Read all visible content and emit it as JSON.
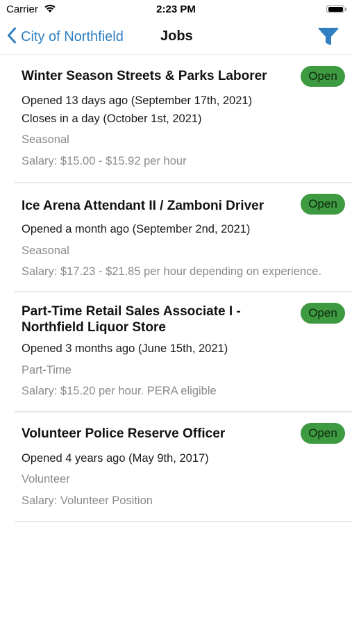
{
  "status_bar": {
    "carrier": "Carrier",
    "time": "2:23 PM"
  },
  "nav": {
    "back_label": "City of Northfield",
    "title": "Jobs",
    "accent_color": "#2f7fc1"
  },
  "jobs": [
    {
      "title": "Winter Season Streets & Parks Laborer",
      "status": "Open",
      "opened": "Opened 13 days ago (September 17th, 2021)",
      "closes": "Closes in a day (October 1st, 2021)",
      "type": "Seasonal",
      "salary": "Salary: $15.00 - $15.92 per hour"
    },
    {
      "title": "Ice Arena Attendant II / Zamboni Driver",
      "status": "Open",
      "opened": "Opened a month ago (September 2nd, 2021)",
      "type": "Seasonal",
      "salary": "Salary: $17.23 - $21.85 per hour depending on experience."
    },
    {
      "title_line1": "Part-Time Retail Sales Associate I -",
      "title_line2": "Northfield Liquor Store",
      "status": "Open",
      "opened": "Opened 3 months ago (June 15th, 2021)",
      "type": "Part-Time",
      "salary": "Salary: $15.20 per hour. PERA eligible"
    },
    {
      "title": "Volunteer Police Reserve Officer",
      "status": "Open",
      "opened": "Opened 4 years ago (May 9th, 2017)",
      "type": "Volunteer",
      "salary": "Salary: Volunteer Position"
    }
  ],
  "colors": {
    "badge_open": "#3e9a40",
    "secondary_text": "#8a8a8a"
  },
  "icons": [
    "wifi-icon",
    "battery-icon",
    "chevron-left-icon",
    "filter-icon"
  ]
}
